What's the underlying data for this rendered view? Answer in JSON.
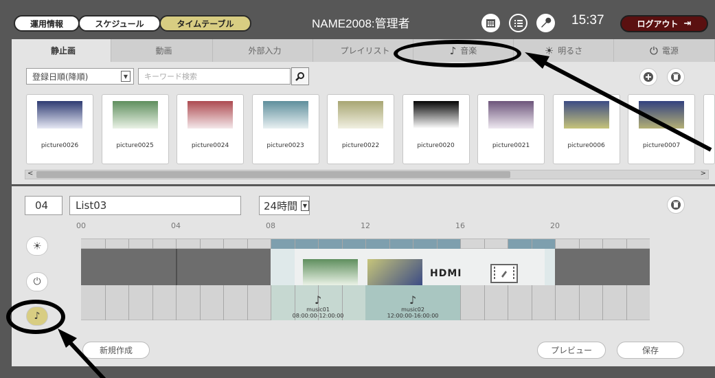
{
  "header": {
    "btn_ops": "運用情報",
    "btn_schedule": "スケジュール",
    "btn_timetable": "タイムテーブル",
    "title": "NAME2008:管理者",
    "clock": "15:37",
    "logout": "ログアウト",
    "icons": [
      "calendar-icon",
      "list-icon",
      "wrench-icon",
      "logout-icon"
    ]
  },
  "tabs": [
    {
      "label": "静止画",
      "icon": ""
    },
    {
      "label": "動画",
      "icon": ""
    },
    {
      "label": "外部入力",
      "icon": ""
    },
    {
      "label": "プレイリスト",
      "icon": ""
    },
    {
      "label": "音楽",
      "icon": "♪"
    },
    {
      "label": "明るさ",
      "icon": "☀"
    },
    {
      "label": "電源",
      "icon": "⏻"
    }
  ],
  "library": {
    "sort_value": "登録日順(降順)",
    "search_placeholder": "キーワード検索",
    "items": [
      {
        "name": "picture0026",
        "grad": [
          "#2e3b72",
          "#e6e8f4"
        ]
      },
      {
        "name": "picture0025",
        "grad": [
          "#5f8f5e",
          "#eaf2e6"
        ]
      },
      {
        "name": "picture0024",
        "grad": [
          "#ad4a50",
          "#f4e8ea"
        ]
      },
      {
        "name": "picture0023",
        "grad": [
          "#5f8f9c",
          "#e8f0f2"
        ]
      },
      {
        "name": "picture0022",
        "grad": [
          "#a8a673",
          "#f1f0e2"
        ]
      },
      {
        "name": "picture0020",
        "grad": [
          "#050505",
          "#ffffff"
        ]
      },
      {
        "name": "picture0021",
        "grad": [
          "#6d557b",
          "#eee8f0"
        ]
      },
      {
        "name": "picture0006",
        "grad": [
          "#3c4c85",
          "#c6c47a"
        ]
      },
      {
        "name": "picture0007",
        "grad": [
          "#33427f",
          "#b4b076"
        ]
      }
    ]
  },
  "timeline": {
    "list_number": "04",
    "list_name": "List03",
    "hours": "24時間",
    "hour_labels": [
      "00",
      "04",
      "08",
      "12",
      "16",
      "20"
    ],
    "hdmi": "HDMI",
    "music": [
      {
        "name": "music01",
        "time": "08:00:00-12:00:00"
      },
      {
        "name": "music02",
        "time": "12:00:00-16:00:00"
      }
    ],
    "btn_new": "新規作成",
    "btn_preview": "プレビュー",
    "btn_save": "保存"
  },
  "colors": {
    "accent": "#d8cd82",
    "logout": "#5a1010",
    "frame": "#575757"
  }
}
